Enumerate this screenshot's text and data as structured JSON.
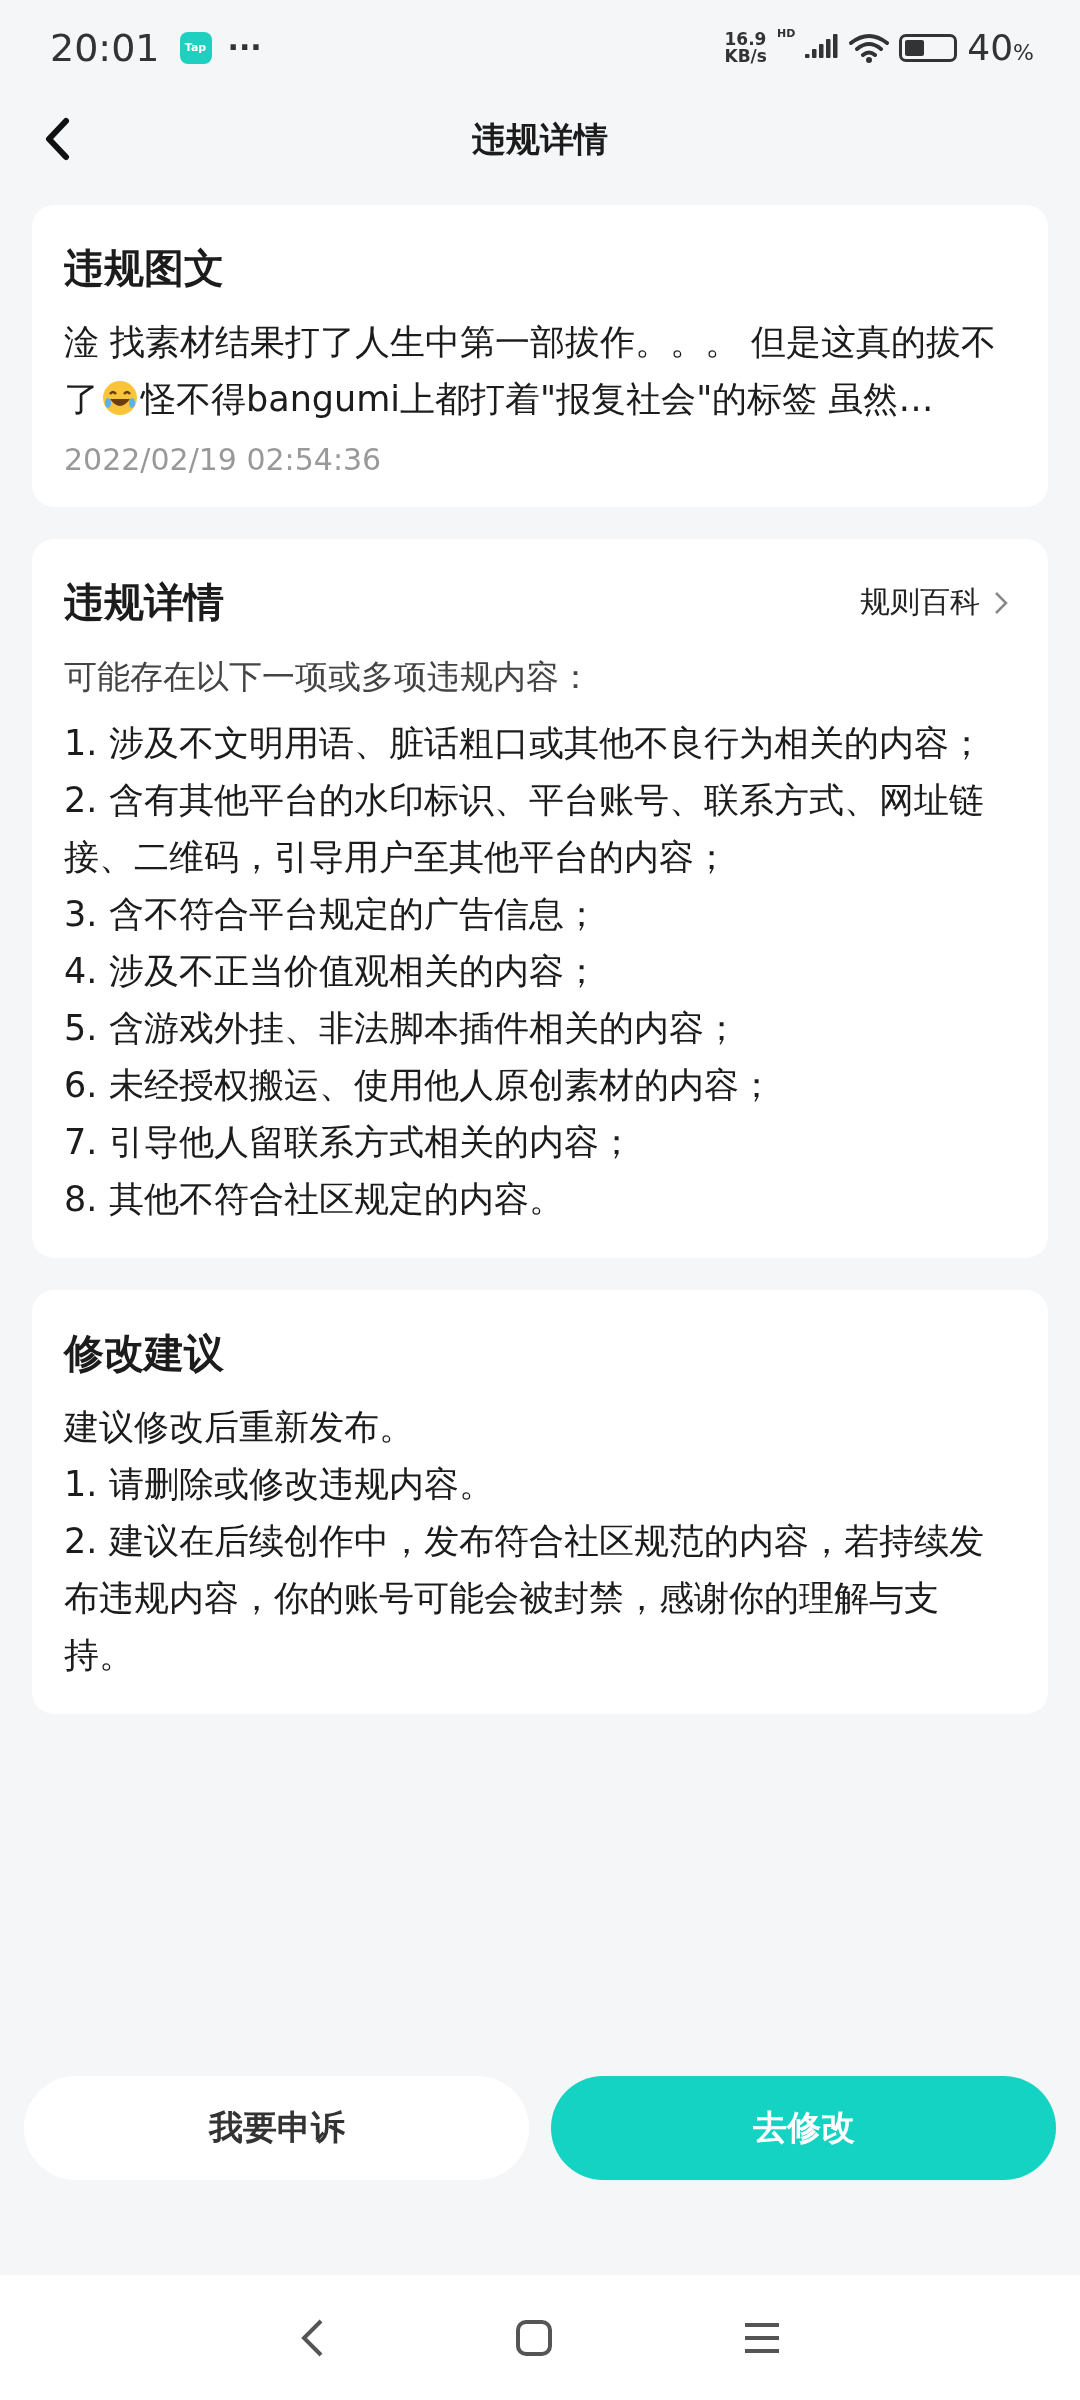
{
  "status_bar": {
    "time": "20:01",
    "app_badge": "Tap",
    "more": "···",
    "net_speed_value": "16.9",
    "net_speed_unit": "KB/s",
    "signal_label": "HD",
    "battery": "40",
    "battery_unit": "%"
  },
  "header": {
    "title": "违规详情"
  },
  "post_card": {
    "title": "违规图文",
    "excerpt_before_emoji": "淦 找素材结果打了人生中第一部拔作。。。 但是这真的拔不了",
    "excerpt_after_emoji": "怪不得bangumi上都打着\"报复社会\"的标签 虽然…",
    "date": "2022/02/19 02:54:36"
  },
  "detail_card": {
    "title": "违规详情",
    "link": "规则百科",
    "intro": "可能存在以下一项或多项违规内容：",
    "items": [
      "1. 涉及不文明用语、脏话粗口或其他不良行为相关的内容；",
      "2. 含有其他平台的水印标识、平台账号、联系方式、网址链接、二维码，引导用户至其他平台的内容；",
      "3. 含不符合平台规定的广告信息；",
      "4. 涉及不正当价值观相关的内容；",
      "5. 含游戏外挂、非法脚本插件相关的内容；",
      "6. 未经授权搬运、使用他人原创素材的内容；",
      "7. 引导他人留联系方式相关的内容；",
      "8. 其他不符合社区规定的内容。"
    ]
  },
  "advice_card": {
    "title": "修改建议",
    "lines": [
      "建议修改后重新发布。",
      "1. 请删除或修改违规内容。",
      "2. 建议在后续创作中，发布符合社区规范的内容，若持续发布违规内容，你的账号可能会被封禁，感谢你的理解与支持。"
    ]
  },
  "buttons": [
    {
      "label": "我要申诉",
      "kind": "secondary"
    },
    {
      "label": "去修改",
      "kind": "primary"
    }
  ]
}
